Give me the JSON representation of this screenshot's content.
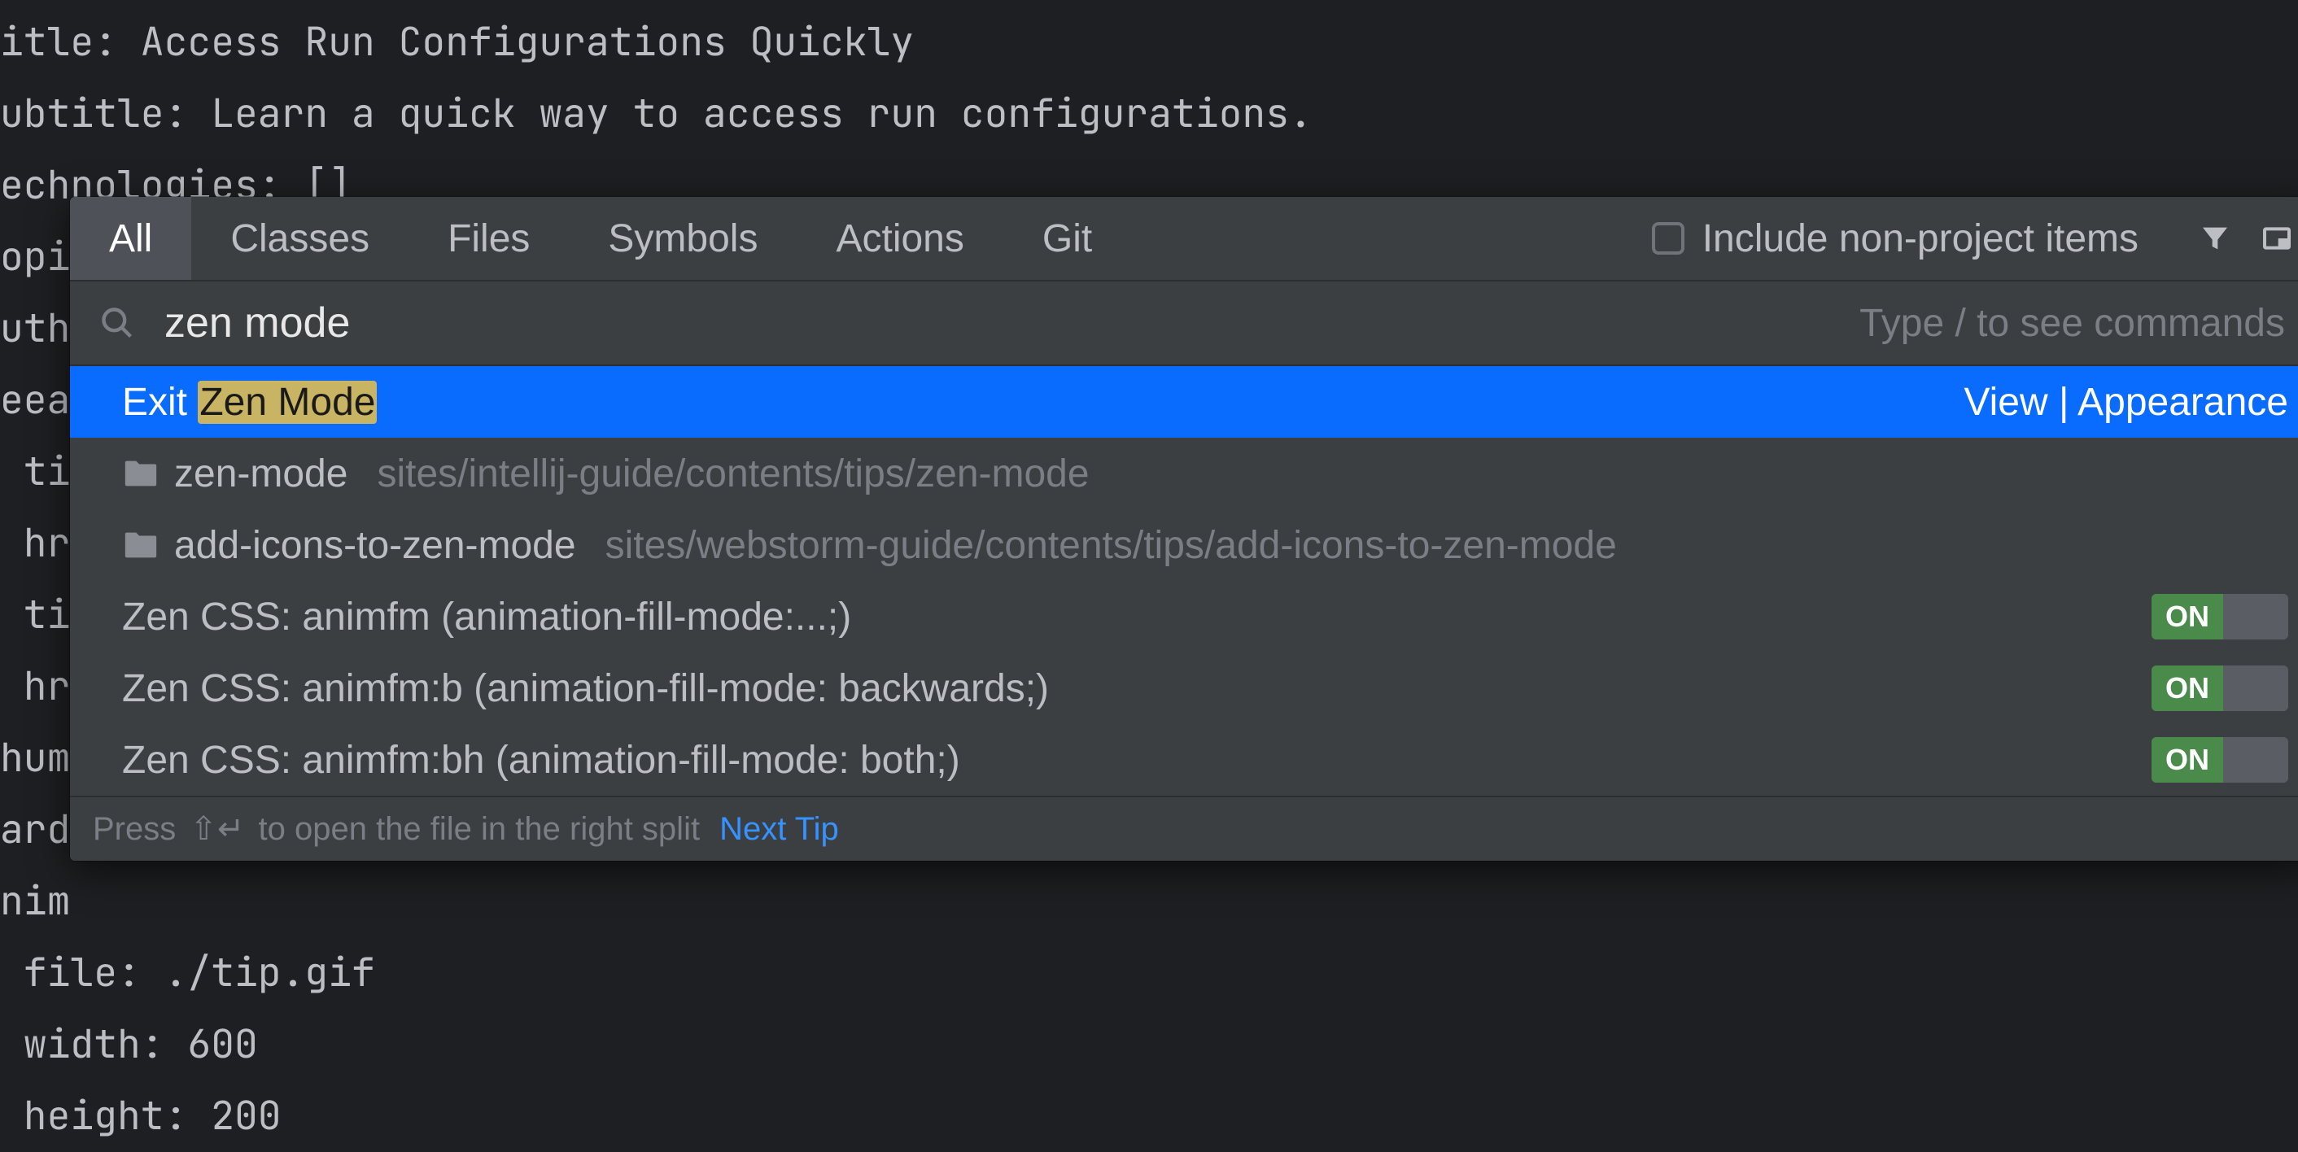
{
  "editor": {
    "lines": [
      "itle: Access Run Configurations Quickly",
      "ubtitle: Learn a quick way to access run configurations.",
      "echnologies: []",
      "opi",
      "uth",
      "eea",
      " ti",
      " hr",
      " ti",
      " hr",
      "hum",
      "ard",
      "nim",
      " file: ./tip.gif",
      " width: 600",
      " height: 200"
    ]
  },
  "popup": {
    "tabs": [
      "All",
      "Classes",
      "Files",
      "Symbols",
      "Actions",
      "Git"
    ],
    "active_tab": "All",
    "include_label": "Include non-project items",
    "include_checked": false,
    "search_value": "zen mode",
    "search_hint": "Type / to see commands",
    "results": [
      {
        "type": "action",
        "selected": true,
        "prefix": "Exit ",
        "match": "Zen Mode",
        "right": "View | Appearance"
      },
      {
        "type": "folder",
        "name": "zen-mode",
        "path": "sites/intellij-guide/contents/tips/zen-mode"
      },
      {
        "type": "folder",
        "name": "add-icons-to-zen-mode",
        "path": "sites/webstorm-guide/contents/tips/add-icons-to-zen-mode"
      },
      {
        "type": "toggle",
        "label": "Zen CSS: animfm (animation-fill-mode:...;)",
        "state": "ON"
      },
      {
        "type": "toggle",
        "label": "Zen CSS: animfm:b (animation-fill-mode: backwards;)",
        "state": "ON"
      },
      {
        "type": "toggle",
        "label": "Zen CSS: animfm:bh (animation-fill-mode: both;)",
        "state": "ON"
      }
    ],
    "footer_hint_prefix": "Press ",
    "footer_hint_keys": "⇧↵",
    "footer_hint_suffix": " to open the file in the right split",
    "footer_link": "Next Tip"
  }
}
